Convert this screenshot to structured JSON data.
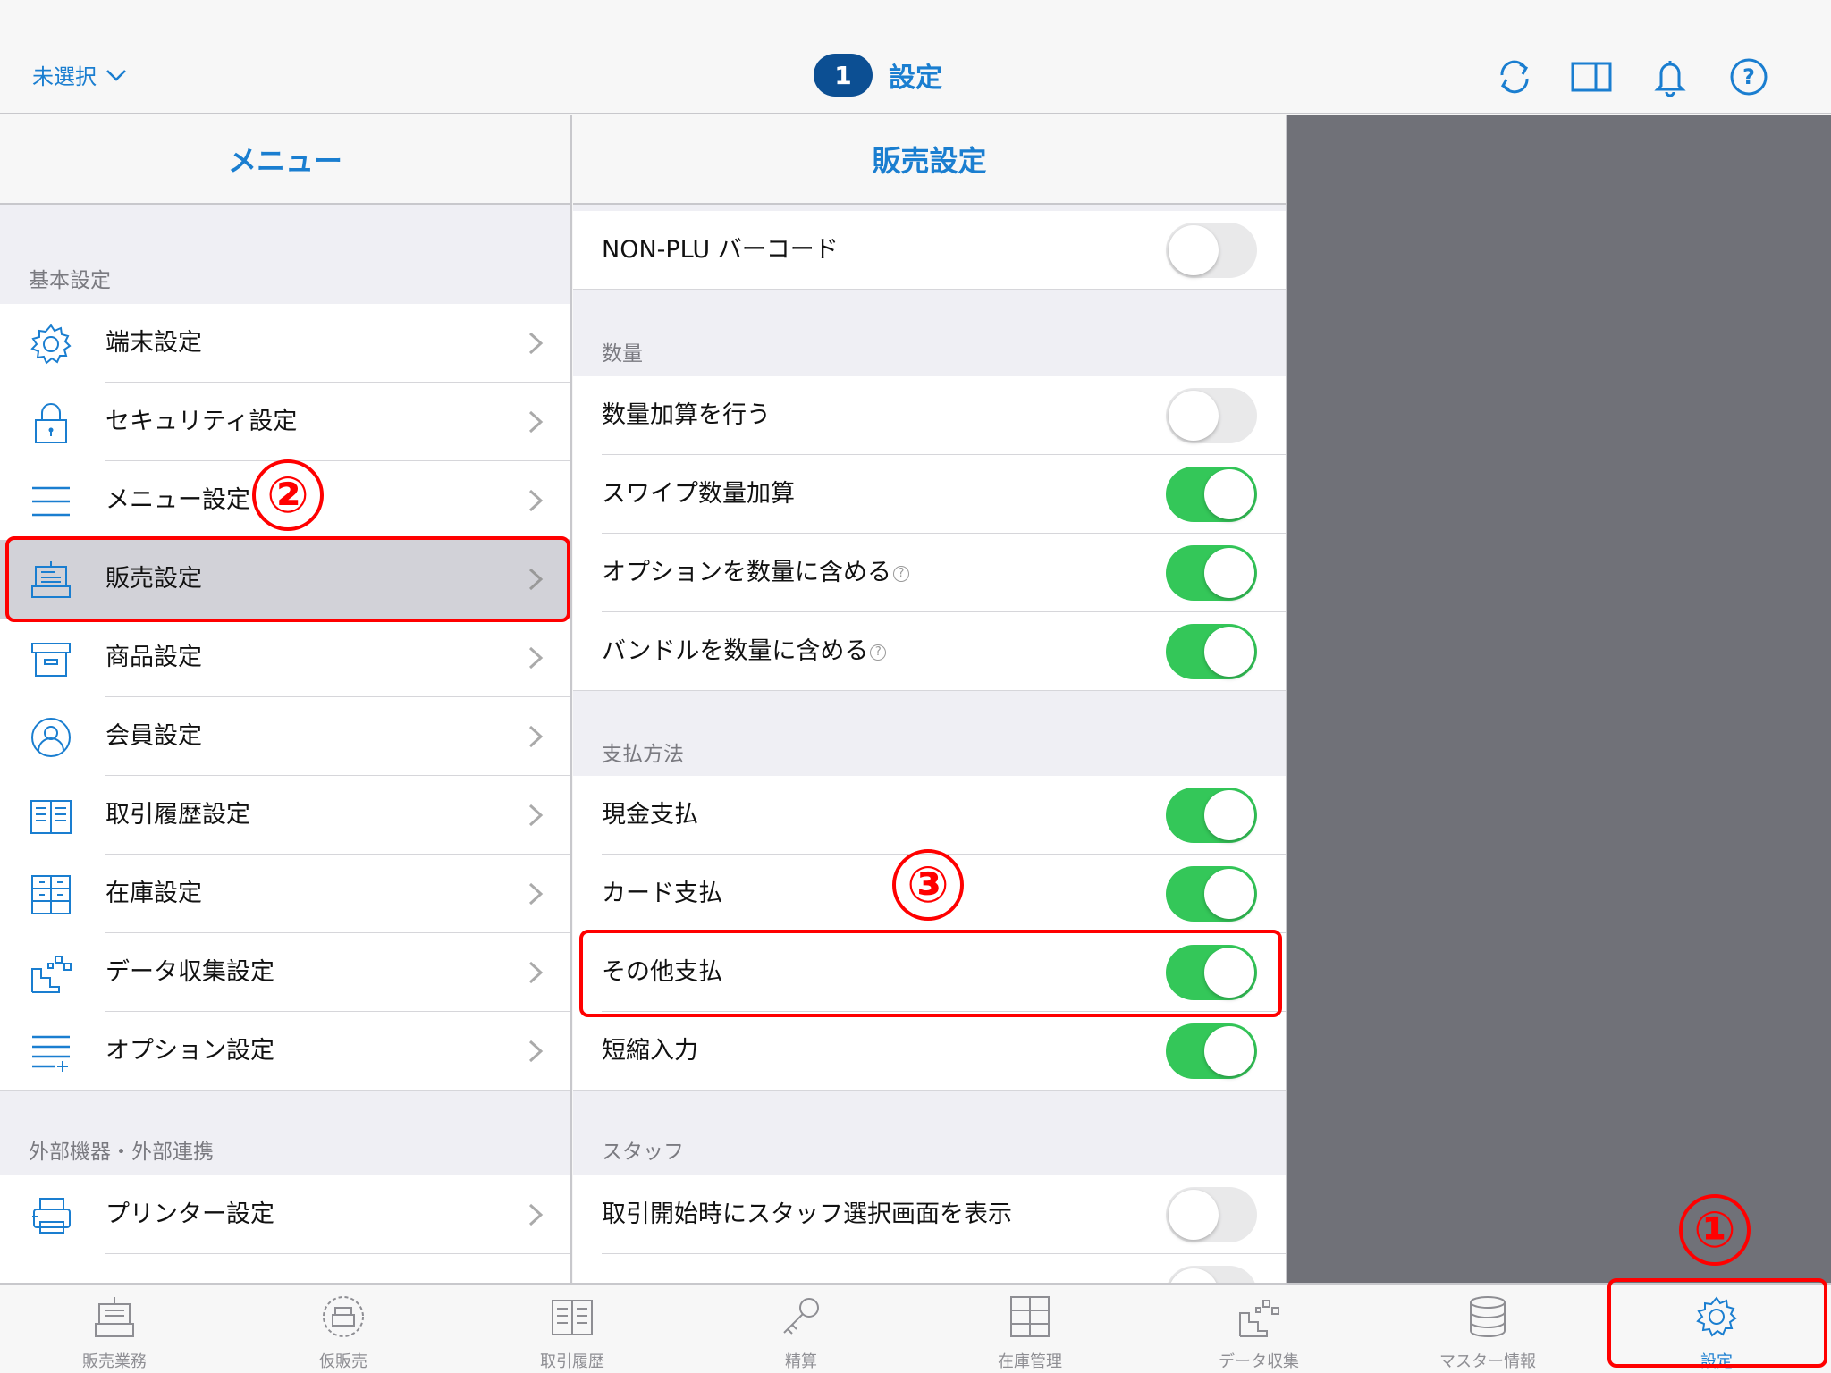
{
  "top_bar": {
    "store_selector": "未選択",
    "badge_count": "1",
    "title": "設定",
    "icons": [
      "sync-icon",
      "split-view-icon",
      "bell-icon",
      "help-icon"
    ]
  },
  "menu": {
    "header": "メニュー",
    "sections": [
      {
        "label": "基本設定",
        "items": [
          {
            "label": "端末設定",
            "icon": "gear-icon"
          },
          {
            "label": "セキュリティ設定",
            "icon": "lock-icon"
          },
          {
            "label": "メニュー設定",
            "icon": "menu-lines-icon"
          },
          {
            "label": "販売設定",
            "icon": "register-icon",
            "selected": true
          },
          {
            "label": "商品設定",
            "icon": "box-icon"
          },
          {
            "label": "会員設定",
            "icon": "person-icon"
          },
          {
            "label": "取引履歴設定",
            "icon": "book-icon"
          },
          {
            "label": "在庫設定",
            "icon": "cabinet-icon"
          },
          {
            "label": "データ収集設定",
            "icon": "data-icon"
          },
          {
            "label": "オプション設定",
            "icon": "list-plus-icon"
          }
        ]
      },
      {
        "label": "外部機器・外部連携",
        "items": [
          {
            "label": "プリンター設定",
            "icon": "printer-icon"
          }
        ]
      }
    ]
  },
  "sales_settings": {
    "header": "販売設定",
    "rows_top": [
      {
        "label": "NON-PLU バーコード",
        "on": false
      }
    ],
    "sections": [
      {
        "label": "数量",
        "rows": [
          {
            "label": "数量加算を行う",
            "on": false
          },
          {
            "label": "スワイプ数量加算",
            "on": true
          },
          {
            "label": "オプションを数量に含める",
            "on": true,
            "help": true
          },
          {
            "label": "バンドルを数量に含める",
            "on": true,
            "help": true
          }
        ]
      },
      {
        "label": "支払方法",
        "rows": [
          {
            "label": "現金支払",
            "on": true
          },
          {
            "label": "カード支払",
            "on": true
          },
          {
            "label": "その他支払",
            "on": true
          },
          {
            "label": "短縮入力",
            "on": true
          }
        ]
      },
      {
        "label": "スタッフ",
        "rows": [
          {
            "label": "取引開始時にスタッフ選択画面を表示",
            "on": false
          }
        ]
      }
    ],
    "help_glyph": "?"
  },
  "annotations": {
    "one": "①",
    "two": "②",
    "three": "③",
    "color": "#ff0000"
  },
  "tab_bar": {
    "tabs": [
      {
        "label": "販売業務",
        "icon": "register-icon"
      },
      {
        "label": "仮販売",
        "icon": "temp-sale-icon"
      },
      {
        "label": "取引履歴",
        "icon": "history-icon"
      },
      {
        "label": "精算",
        "icon": "key-icon"
      },
      {
        "label": "在庫管理",
        "icon": "cabinet-icon"
      },
      {
        "label": "データ収集",
        "icon": "data-icon"
      },
      {
        "label": "マスター情報",
        "icon": "database-icon"
      },
      {
        "label": "設定",
        "icon": "gear-icon",
        "active": true
      }
    ]
  },
  "colors": {
    "accent": "#1a7ed0",
    "toggle_on": "#34c759",
    "badge": "#0c4f93",
    "annotation": "#ff0000"
  }
}
